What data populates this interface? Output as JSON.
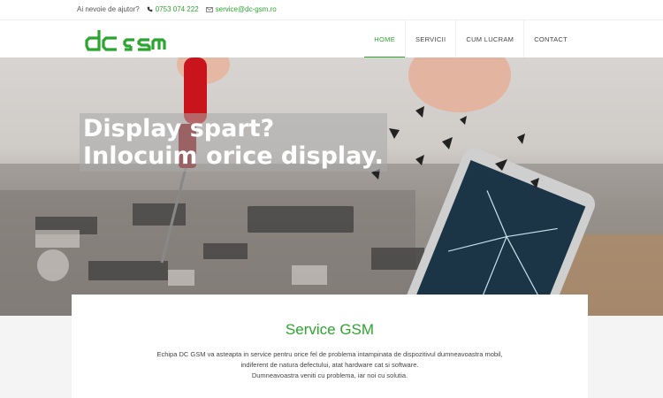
{
  "topbar": {
    "help_text": "Ai nevoie de ajutor?",
    "phone": "0753 074 222",
    "email": "service@dc-gsm.ro",
    "phone_icon": "phone-icon",
    "email_icon": "envelope-icon"
  },
  "brand": {
    "logo_text": "dc GSM",
    "accent_color": "#2aa52e"
  },
  "nav": {
    "items": [
      {
        "label": "HOME",
        "active": true
      },
      {
        "label": "SERVICII",
        "active": false
      },
      {
        "label": "CUM LUCRAM",
        "active": false
      },
      {
        "label": "CONTACT",
        "active": false
      }
    ]
  },
  "hero": {
    "line1": "Display spart?",
    "line2": "Inlocuim orice display."
  },
  "section": {
    "title": "Service GSM",
    "lines": [
      "Echipa DC GSM va asteapta in service pentru orice fel de problema intampinata de dispozitivul dumneavoastra mobil,",
      "indiferent de natura defectului, atat hardware cat si software.",
      "Dumneavoastra veniti cu problema, iar noi cu solutia."
    ]
  }
}
